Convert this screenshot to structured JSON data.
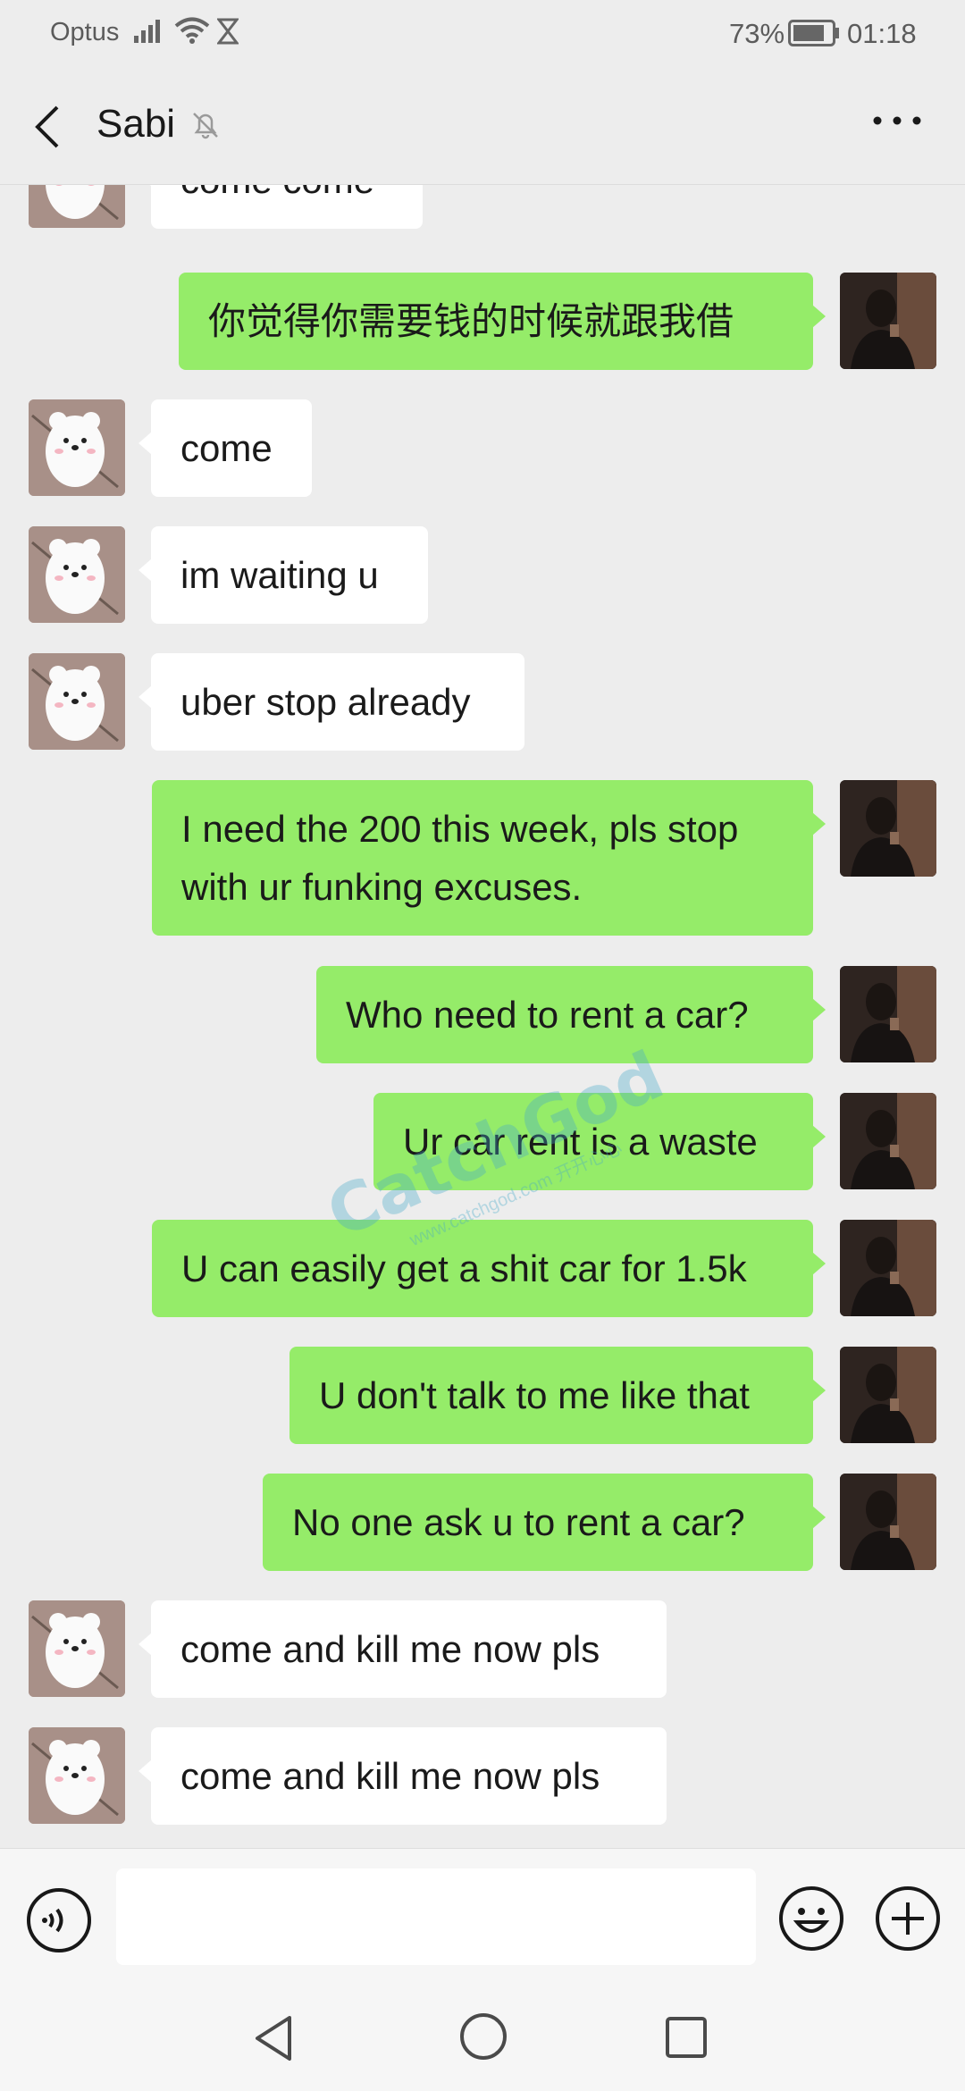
{
  "status_bar": {
    "carrier": "Optus",
    "battery": "73%",
    "time": "01:18"
  },
  "header": {
    "title": "Sabi"
  },
  "messages": [
    {
      "from": "them",
      "text": "come come"
    },
    {
      "from": "me",
      "text": "你觉得你需要钱的时候就跟我借"
    },
    {
      "from": "them",
      "text": "come"
    },
    {
      "from": "them",
      "text": "im waiting u"
    },
    {
      "from": "them",
      "text": "uber stop already"
    },
    {
      "from": "me",
      "text": "I need the 200 this week, pls stop with ur funking excuses."
    },
    {
      "from": "me",
      "text": "Who need to rent a car?"
    },
    {
      "from": "me",
      "text": "Ur car rent is a waste"
    },
    {
      "from": "me",
      "text": "U can easily get a shit car for 1.5k"
    },
    {
      "from": "me",
      "text": "U don't talk to me like that"
    },
    {
      "from": "me",
      "text": "No one ask u to rent a car?"
    },
    {
      "from": "them",
      "text": "come and kill me now pls"
    },
    {
      "from": "them",
      "text": "come and kill me now pls"
    }
  ],
  "watermark": {
    "logo": "CatchGod",
    "url": "www.catchgod.com 开开心心"
  },
  "colors": {
    "background": "#ededed",
    "outgoing_bubble": "#95ec69",
    "incoming_bubble": "#ffffff"
  },
  "icons": {
    "status": [
      "signal-icon",
      "wifi-icon",
      "hourglass-icon",
      "battery-icon"
    ],
    "header": [
      "back-icon",
      "mute-bell-icon",
      "more-icon"
    ],
    "input": [
      "voice-icon",
      "emoji-icon",
      "plus-icon"
    ],
    "nav": [
      "nav-back-icon",
      "nav-home-icon",
      "nav-recent-icon"
    ]
  }
}
